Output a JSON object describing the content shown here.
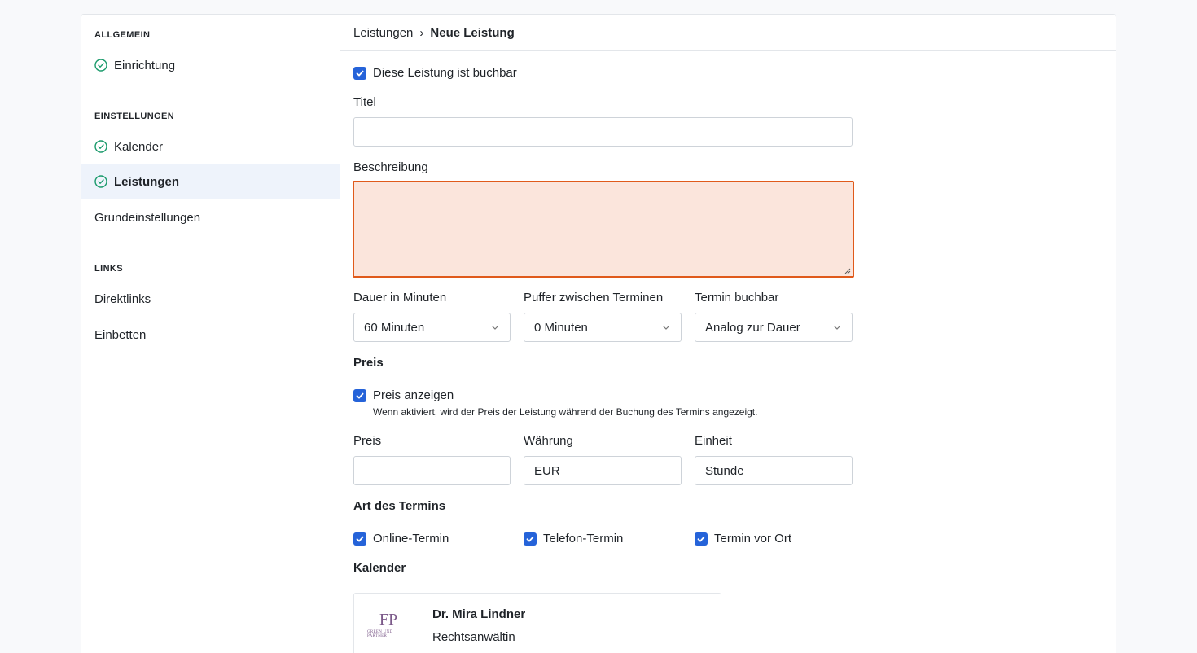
{
  "sidebar": {
    "sections": [
      {
        "heading": "ALLGEMEIN",
        "items": [
          {
            "label": "Einrichtung",
            "icon": "check-circle-icon",
            "done": true
          }
        ]
      },
      {
        "heading": "EINSTELLUNGEN",
        "items": [
          {
            "label": "Kalender",
            "icon": "check-circle-icon",
            "done": true
          },
          {
            "label": "Leistungen",
            "icon": "check-circle-icon",
            "done": true,
            "active": true
          },
          {
            "label": "Grundeinstellungen"
          }
        ]
      },
      {
        "heading": "LINKS",
        "items": [
          {
            "label": "Direktlinks"
          },
          {
            "label": "Einbetten"
          }
        ]
      }
    ]
  },
  "breadcrumb": {
    "parent": "Leistungen",
    "separator": "›",
    "current": "Neue Leistung"
  },
  "form": {
    "bookable": {
      "label": "Diese Leistung ist buchbar",
      "checked": true
    },
    "title": {
      "label": "Titel",
      "value": ""
    },
    "description": {
      "label": "Beschreibung",
      "value": ""
    },
    "duration": {
      "label": "Dauer in Minuten",
      "value": "60 Minuten"
    },
    "buffer": {
      "label": "Puffer zwischen Terminen",
      "value": "0 Minuten"
    },
    "bookable_slot": {
      "label": "Termin buchbar",
      "value": "Analog zur Dauer"
    },
    "price_section": {
      "heading": "Preis"
    },
    "show_price": {
      "label": "Preis anzeigen",
      "checked": true,
      "help": "Wenn aktiviert, wird der Preis der Leistung während der Buchung des Termins angezeigt."
    },
    "price": {
      "label": "Preis",
      "value": ""
    },
    "currency": {
      "label": "Währung",
      "value": "EUR"
    },
    "unit": {
      "label": "Einheit",
      "value": "Stunde"
    },
    "appointment_type": {
      "heading": "Art des Termins",
      "options": [
        {
          "label": "Online-Termin",
          "checked": true
        },
        {
          "label": "Telefon-Termin",
          "checked": true
        },
        {
          "label": "Termin vor Ort",
          "checked": true
        }
      ]
    },
    "calendar": {
      "heading": "Kalender",
      "card": {
        "name": "Dr. Mira Lindner",
        "role": "Rechtsanwältin",
        "logo_mono": "FP",
        "logo_sub": "GREEN UND PARTNER"
      }
    }
  },
  "colors": {
    "accent": "#2563d9",
    "success": "#1a9a6b",
    "error_border": "#e05a1b",
    "error_bg": "#fbe5dc"
  }
}
